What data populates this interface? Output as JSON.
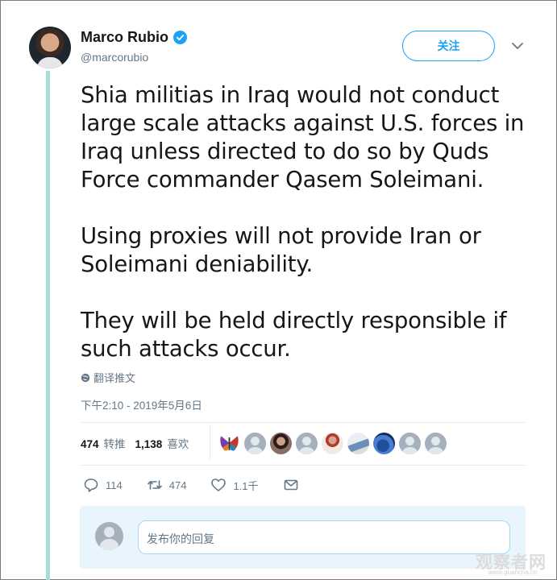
{
  "author": {
    "name": "Marco Rubio",
    "handle": "@marcorubio",
    "verified": true
  },
  "follow_button": {
    "label": "关注"
  },
  "tweet": {
    "paragraphs": [
      "Shia militias in Iraq would not conduct large scale attacks against U.S. forces in Iraq unless directed to do so by Quds Force commander Qasem Soleimani.",
      "Using proxies will not provide Iran or Soleimani deniability.",
      "They will be held directly responsible if such attacks occur."
    ],
    "translate_label": "翻译推文",
    "timestamp": "下午2:10 - 2019年5月6日"
  },
  "stats": {
    "retweets_count": "474",
    "retweets_label": "转推",
    "likes_count": "1,138",
    "likes_label": "喜欢"
  },
  "actions": {
    "reply_count": "114",
    "retweet_count": "474",
    "like_count": "1.1千"
  },
  "reply": {
    "placeholder": "发布你的回复"
  },
  "watermark": {
    "text": "观察者网",
    "sub": "www.guancha.cn"
  },
  "colors": {
    "accent": "#1da1f2",
    "thread_line": "#a8dcd8",
    "reply_bg": "#e8f5fd",
    "muted_text": "#657786"
  },
  "icons": [
    "verified-badge-icon",
    "chevron-down-icon",
    "globe-icon",
    "reply-icon",
    "retweet-icon",
    "like-icon",
    "message-icon"
  ]
}
